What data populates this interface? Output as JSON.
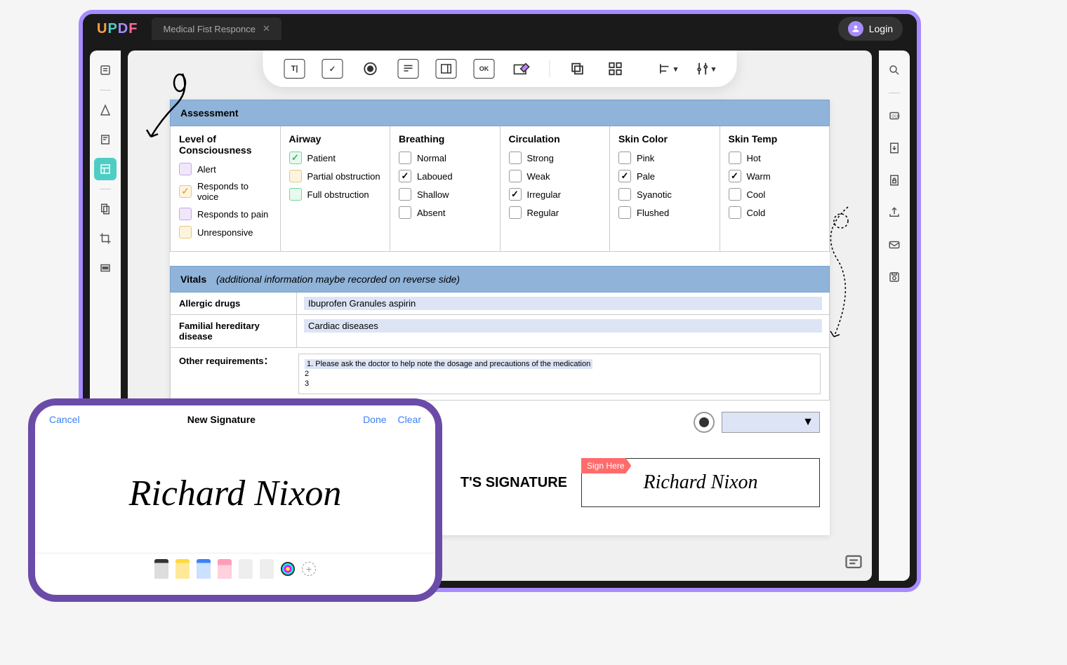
{
  "titlebar": {
    "tab": "Medical Fist Responce",
    "login": "Login"
  },
  "assessment": {
    "title": "Assessment",
    "cols": [
      {
        "h": "Level of Consciousness",
        "items": [
          {
            "l": "Alert",
            "c": "purple"
          },
          {
            "l": "Responds to voice",
            "c": "yellow",
            "checked": true
          },
          {
            "l": "Responds to pain",
            "c": "purple"
          },
          {
            "l": "Unresponsive",
            "c": "yellow"
          }
        ]
      },
      {
        "h": "Airway",
        "items": [
          {
            "l": "Patient",
            "c": "green",
            "checked": true
          },
          {
            "l": "Partial obstruction",
            "c": "yellow"
          },
          {
            "l": "Full obstruction",
            "c": "green"
          }
        ]
      },
      {
        "h": "Breathing",
        "items": [
          {
            "l": "Normal"
          },
          {
            "l": "Laboued",
            "checked": true
          },
          {
            "l": "Shallow"
          },
          {
            "l": "Absent"
          }
        ]
      },
      {
        "h": "Circulation",
        "items": [
          {
            "l": "Strong"
          },
          {
            "l": "Weak"
          },
          {
            "l": "Irregular",
            "checked": true
          },
          {
            "l": "Regular"
          }
        ]
      },
      {
        "h": "Skin Color",
        "items": [
          {
            "l": "Pink"
          },
          {
            "l": "Pale",
            "checked": true
          },
          {
            "l": "Syanotic"
          },
          {
            "l": "Flushed"
          }
        ]
      },
      {
        "h": "Skin Temp",
        "items": [
          {
            "l": "Hot"
          },
          {
            "l": "Warm",
            "checked": true
          },
          {
            "l": "Cool"
          },
          {
            "l": "Cold"
          }
        ]
      }
    ]
  },
  "vitals": {
    "title": "Vitals",
    "note": "(additional information maybe recorded on reverse side)",
    "rows": [
      {
        "label": "Allergic drugs",
        "value": "Ibuprofen Granules  aspirin"
      },
      {
        "label": "Familial hereditary disease",
        "value": "Cardiac diseases"
      }
    ],
    "other_label": "Other requirements：",
    "other_items": [
      "1. Please ask the doctor to help note the dosage and precautions of the medication",
      "2",
      "3"
    ]
  },
  "signature": {
    "label": "T'S SIGNATURE",
    "sign_here": "Sign Here",
    "name": "Richard Nixon"
  },
  "phone": {
    "cancel": "Cancel",
    "title": "New Signature",
    "done": "Done",
    "clear": "Clear",
    "sig": "Richard Nixon"
  }
}
